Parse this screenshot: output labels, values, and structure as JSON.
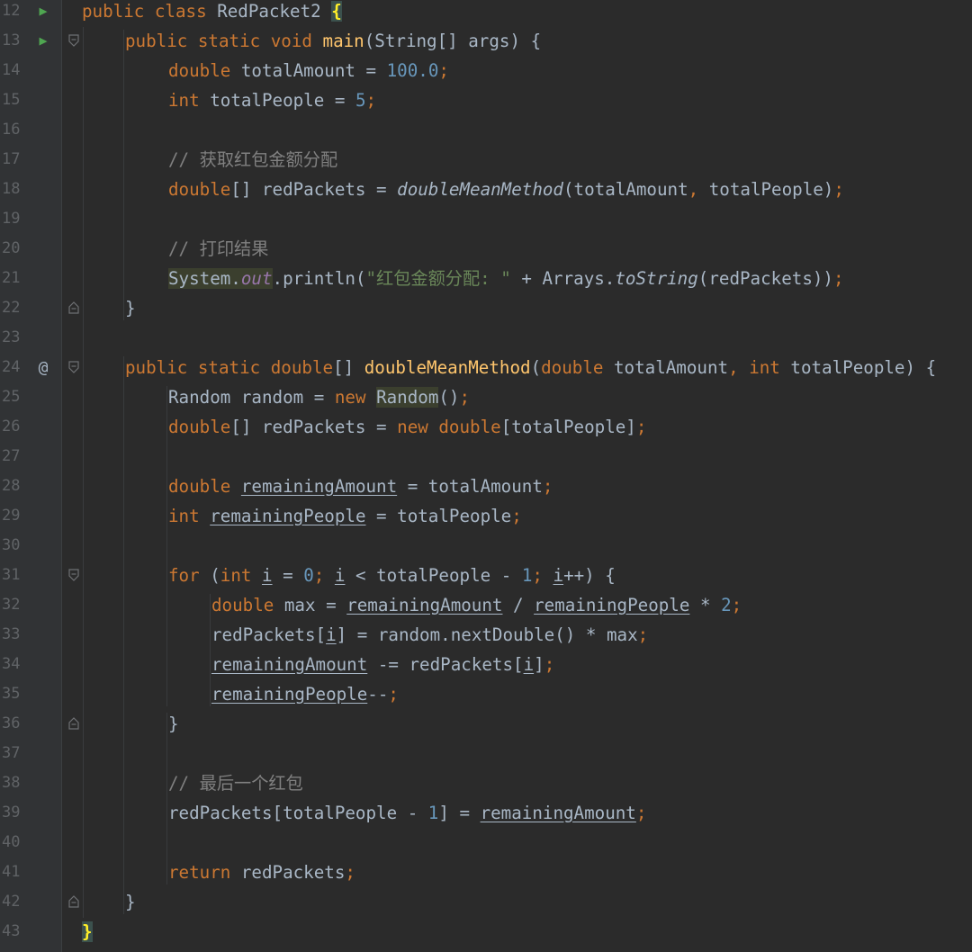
{
  "editor": {
    "colors": {
      "background": "#2b2b2b",
      "gutter": "#313335",
      "keyword": "#cc7832",
      "number": "#6897bb",
      "comment": "#808080",
      "string": "#6a8759",
      "method": "#ffc66d",
      "field": "#9876aa",
      "text": "#a9b7c6"
    },
    "icons": {
      "run": "run-triangle-icon",
      "override": "at-sign-icon",
      "fold": "fold-marker-icon"
    },
    "lines": [
      {
        "n": "12",
        "gutter": "run",
        "fold": "none",
        "tokens": [
          [
            "kw",
            "public "
          ],
          [
            "kw",
            "class "
          ],
          [
            "",
            "RedPacket2 "
          ],
          [
            "brace-hl",
            "{"
          ]
        ]
      },
      {
        "n": "13",
        "gutter": "run",
        "fold": "open",
        "indent": 1,
        "tokens": [
          [
            "kw",
            "public "
          ],
          [
            "kw",
            "static "
          ],
          [
            "kw",
            "void "
          ],
          [
            "fn",
            "main"
          ],
          [
            "",
            "(String[] args) {"
          ]
        ]
      },
      {
        "n": "14",
        "indent": 2,
        "tokens": [
          [
            "kw",
            "double "
          ],
          [
            "",
            "totalAmount = "
          ],
          [
            "num",
            "100.0"
          ],
          [
            "kw",
            ";"
          ]
        ]
      },
      {
        "n": "15",
        "indent": 2,
        "tokens": [
          [
            "kw",
            "int "
          ],
          [
            "",
            "totalPeople = "
          ],
          [
            "num",
            "5"
          ],
          [
            "kw",
            ";"
          ]
        ]
      },
      {
        "n": "16",
        "tokens": []
      },
      {
        "n": "17",
        "indent": 2,
        "tokens": [
          [
            "cmt",
            "// 获取红包金额分配"
          ]
        ]
      },
      {
        "n": "18",
        "indent": 2,
        "tokens": [
          [
            "kw",
            "double"
          ],
          [
            "",
            "[] redPackets = "
          ],
          [
            "ital",
            "doubleMeanMethod"
          ],
          [
            "",
            "(totalAmount"
          ],
          [
            "kw",
            ", "
          ],
          [
            "",
            "totalPeople)"
          ],
          [
            "kw",
            ";"
          ]
        ]
      },
      {
        "n": "19",
        "tokens": []
      },
      {
        "n": "20",
        "indent": 2,
        "tokens": [
          [
            "cmt",
            "// 打印结果"
          ]
        ]
      },
      {
        "n": "21",
        "indent": 2,
        "tokens": [
          [
            "hl",
            "System."
          ],
          [
            "field hl",
            "out"
          ],
          [
            "",
            ".println("
          ],
          [
            "str",
            "\"红包金额分配: \""
          ],
          [
            "",
            " + Arrays."
          ],
          [
            "ital",
            "toString"
          ],
          [
            "",
            "(redPackets))"
          ],
          [
            "kw",
            ";"
          ]
        ]
      },
      {
        "n": "22",
        "fold": "close",
        "indent": 1,
        "tokens": [
          [
            "",
            "}"
          ]
        ]
      },
      {
        "n": "23",
        "tokens": []
      },
      {
        "n": "24",
        "gutter": "override",
        "fold": "open",
        "indent": 1,
        "tokens": [
          [
            "kw",
            "public "
          ],
          [
            "kw",
            "static "
          ],
          [
            "kw",
            "double"
          ],
          [
            "",
            "[] "
          ],
          [
            "fn",
            "doubleMeanMethod"
          ],
          [
            "",
            "("
          ],
          [
            "kw",
            "double "
          ],
          [
            "",
            "totalAmount"
          ],
          [
            "kw",
            ", "
          ],
          [
            "kw",
            "int "
          ],
          [
            "",
            "totalPeople) {"
          ]
        ]
      },
      {
        "n": "25",
        "indent": 2,
        "tokens": [
          [
            "",
            "Random random = "
          ],
          [
            "kw",
            "new "
          ],
          [
            "hl",
            "Random"
          ],
          [
            "",
            "()"
          ],
          [
            "kw",
            ";"
          ]
        ]
      },
      {
        "n": "26",
        "indent": 2,
        "tokens": [
          [
            "kw",
            "double"
          ],
          [
            "",
            "[] redPackets = "
          ],
          [
            "kw",
            "new "
          ],
          [
            "kw",
            "double"
          ],
          [
            "",
            "[totalPeople]"
          ],
          [
            "kw",
            ";"
          ]
        ]
      },
      {
        "n": "27",
        "tokens": []
      },
      {
        "n": "28",
        "indent": 2,
        "tokens": [
          [
            "kw",
            "double "
          ],
          [
            "ul",
            "remainingAmount"
          ],
          [
            "",
            " = totalAmount"
          ],
          [
            "kw",
            ";"
          ]
        ]
      },
      {
        "n": "29",
        "indent": 2,
        "tokens": [
          [
            "kw",
            "int "
          ],
          [
            "ul",
            "remainingPeople"
          ],
          [
            "",
            " = totalPeople"
          ],
          [
            "kw",
            ";"
          ]
        ]
      },
      {
        "n": "30",
        "tokens": []
      },
      {
        "n": "31",
        "fold": "open",
        "indent": 2,
        "tokens": [
          [
            "kw",
            "for "
          ],
          [
            "",
            "("
          ],
          [
            "kw",
            "int "
          ],
          [
            "ul",
            "i"
          ],
          [
            "",
            " = "
          ],
          [
            "num",
            "0"
          ],
          [
            "kw",
            "; "
          ],
          [
            "ul",
            "i"
          ],
          [
            "",
            " < totalPeople - "
          ],
          [
            "num",
            "1"
          ],
          [
            "kw",
            "; "
          ],
          [
            "ul",
            "i"
          ],
          [
            "",
            "++) {"
          ]
        ]
      },
      {
        "n": "32",
        "indent": 3,
        "tokens": [
          [
            "kw",
            "double "
          ],
          [
            "",
            "max = "
          ],
          [
            "ul",
            "remainingAmount"
          ],
          [
            "",
            " / "
          ],
          [
            "ul",
            "remainingPeople"
          ],
          [
            "",
            " * "
          ],
          [
            "num",
            "2"
          ],
          [
            "kw",
            ";"
          ]
        ]
      },
      {
        "n": "33",
        "indent": 3,
        "tokens": [
          [
            "",
            "redPackets["
          ],
          [
            "ul",
            "i"
          ],
          [
            "",
            "] = random.nextDouble() * max"
          ],
          [
            "kw",
            ";"
          ]
        ]
      },
      {
        "n": "34",
        "indent": 3,
        "tokens": [
          [
            "ul",
            "remainingAmount"
          ],
          [
            "",
            " -= redPackets["
          ],
          [
            "ul",
            "i"
          ],
          [
            "",
            "]"
          ],
          [
            "kw",
            ";"
          ]
        ]
      },
      {
        "n": "35",
        "indent": 3,
        "tokens": [
          [
            "ul",
            "remainingPeople"
          ],
          [
            "",
            "--"
          ],
          [
            "kw",
            ";"
          ]
        ]
      },
      {
        "n": "36",
        "fold": "close",
        "indent": 2,
        "tokens": [
          [
            "",
            "}"
          ]
        ]
      },
      {
        "n": "37",
        "tokens": []
      },
      {
        "n": "38",
        "indent": 2,
        "tokens": [
          [
            "cmt",
            "// 最后一个红包"
          ]
        ]
      },
      {
        "n": "39",
        "indent": 2,
        "tokens": [
          [
            "",
            "redPackets[totalPeople - "
          ],
          [
            "num",
            "1"
          ],
          [
            "",
            "] = "
          ],
          [
            "ul",
            "remainingAmount"
          ],
          [
            "kw",
            ";"
          ]
        ]
      },
      {
        "n": "40",
        "tokens": []
      },
      {
        "n": "41",
        "indent": 2,
        "tokens": [
          [
            "kw",
            "return "
          ],
          [
            "",
            "redPackets"
          ],
          [
            "kw",
            ";"
          ]
        ]
      },
      {
        "n": "42",
        "fold": "close",
        "indent": 1,
        "tokens": [
          [
            "",
            "}"
          ]
        ]
      },
      {
        "n": "43",
        "fold": "none",
        "tokens": [
          [
            "brace-hl",
            "}"
          ]
        ]
      }
    ]
  }
}
